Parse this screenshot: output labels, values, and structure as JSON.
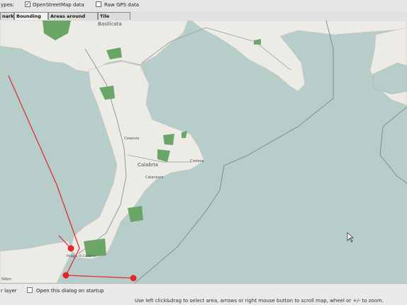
{
  "header": {
    "types_label": "ypes:",
    "osm_checkbox_checked": true,
    "osm_label": "OpenStreetMap data",
    "gps_checkbox_checked": false,
    "gps_label": "Raw GPS data"
  },
  "tabs": [
    {
      "label": "narks"
    },
    {
      "label": "Bounding Box"
    },
    {
      "label": "Areas around places"
    },
    {
      "label": "Tile Numbers"
    }
  ],
  "map": {
    "labels": {
      "basilicata": "Basilicata",
      "cosenza": "Cosenza",
      "calabria": "Calabria",
      "crotone": "Crotone",
      "catanzaro": "Catanzaro",
      "reggio": "Reggio di Calabria",
      "scale": "50km"
    },
    "colors": {
      "sea": "#b7cdca",
      "land": "#ecebe6",
      "forest": "#6aa766",
      "selection": "#e4252a"
    }
  },
  "bottom": {
    "layer_label": "r layer",
    "open_dialog_checked": false,
    "open_dialog_label": "Open this dialog on startup",
    "hint": "Use left click&drag to select area, arrows or right mouse button to scroll map, wheel or +/- to zoom."
  }
}
